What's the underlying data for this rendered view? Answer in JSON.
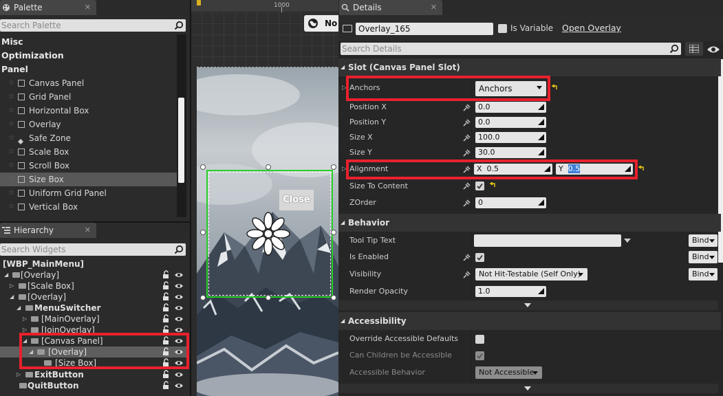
{
  "palette": {
    "tab_title": "Palette",
    "search_placeholder": "Search Palette",
    "categories": [
      "Misc",
      "Optimization",
      "Panel"
    ],
    "items": [
      "Canvas Panel",
      "Grid Panel",
      "Horizontal Box",
      "Overlay",
      "Safe Zone",
      "Scale Box",
      "Scroll Box",
      "Size Box",
      "Uniform Grid Panel",
      "Vertical Box"
    ],
    "selected_item": "Size Box"
  },
  "hierarchy": {
    "tab_title": "Hierarchy",
    "search_placeholder": "Search Widgets",
    "root": "[WBP_MainMenu]",
    "rows": [
      "[Overlay]",
      "[Scale Box]",
      "[Overlay]",
      "MenuSwitcher",
      "[MainOverlay]",
      "[JoinOverlay]",
      "[Canvas Panel]",
      "[Overlay]",
      "[Size Box]",
      "ExitButton",
      "QuitButton"
    ],
    "selected_row": "[Overlay]"
  },
  "viewport": {
    "ruler_label": "1000",
    "toolbar_btn": "No",
    "close_button_label": "Close"
  },
  "details": {
    "tab_title": "Details",
    "widget_name": "Overlay_165",
    "is_variable_label": "Is Variable",
    "open_overlay_label": "Open Overlay",
    "search_placeholder": "Search Details",
    "slot_section": "Slot (Canvas Panel Slot)",
    "anchors_label": "Anchors",
    "anchors_value": "Anchors",
    "position_x_label": "Position X",
    "position_x_value": "0.0",
    "position_y_label": "Position Y",
    "position_y_value": "0.0",
    "size_x_label": "Size X",
    "size_x_value": "100.0",
    "size_y_label": "Size Y",
    "size_y_value": "30.0",
    "alignment_label": "Alignment",
    "alignment_x_prefix": "X",
    "alignment_x_value": "0.5",
    "alignment_y_prefix": "Y",
    "alignment_y_value": "0.5",
    "size_to_content_label": "Size To Content",
    "zorder_label": "ZOrder",
    "zorder_value": "0",
    "behavior_section": "Behavior",
    "tooltip_label": "Tool Tip Text",
    "is_enabled_label": "Is Enabled",
    "visibility_label": "Visibility",
    "visibility_value": "Not Hit-Testable (Self Only)",
    "render_opacity_label": "Render Opacity",
    "render_opacity_value": "1.0",
    "bind_label": "Bind",
    "accessibility_section": "Accessibility",
    "override_accessible_label": "Override Accessible Defaults",
    "can_children_label": "Can Children be Accessible",
    "accessible_behavior_label": "Accessible Behavior",
    "accessible_behavior_value": "Not Accessible"
  },
  "colors": {
    "highlight_red": "#e8212d",
    "selection_green": "#2ad12a",
    "panel_bg": "#2b2b2b"
  }
}
